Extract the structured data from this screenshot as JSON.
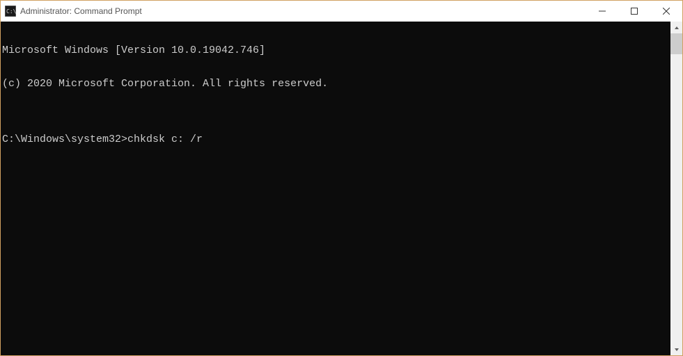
{
  "titlebar": {
    "title": "Administrator: Command Prompt"
  },
  "terminal": {
    "lines": [
      "Microsoft Windows [Version 10.0.19042.746]",
      "(c) 2020 Microsoft Corporation. All rights reserved.",
      "",
      "C:\\Windows\\system32>chkdsk c: /r"
    ]
  }
}
